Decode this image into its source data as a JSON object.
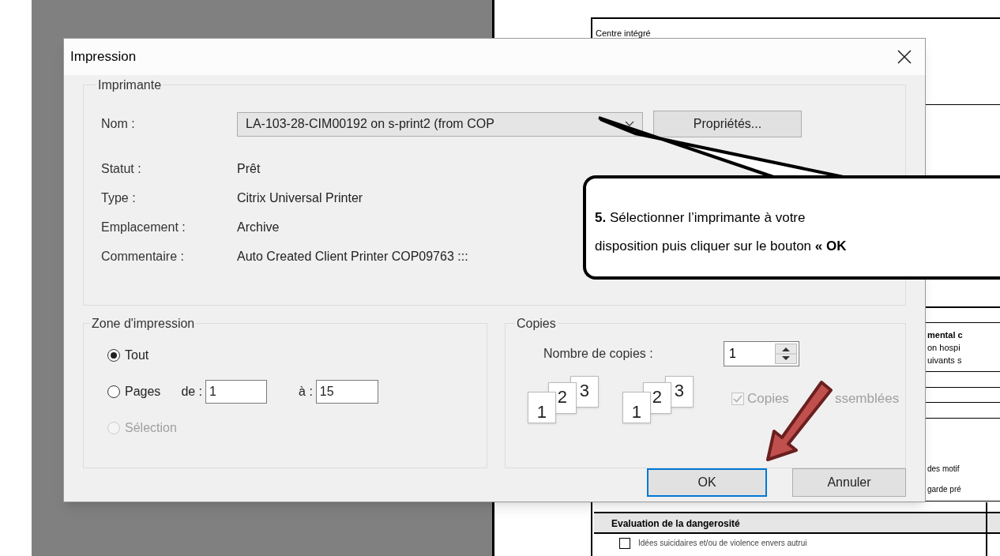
{
  "document": {
    "header": "Centre intégré",
    "fragments": [
      {
        "text": "mental c",
        "bold": true
      },
      {
        "text": "on hospi",
        "bold": false
      },
      {
        "text": "uivants s",
        "bold": false
      },
      {
        "text": "des motif",
        "bold": false
      },
      {
        "text": "garde pré",
        "bold": false
      }
    ],
    "section_title": "Evaluation de la dangerosité",
    "checklist": [
      {
        "label": "Idées suicidaires et/ou de violence envers autrui",
        "checked": false
      }
    ]
  },
  "dialog": {
    "title": "Impression",
    "printer": {
      "legend": "Imprimante",
      "name_label": "Nom :",
      "name_value": "LA-103-28-CIM00192 on s-print2 (from COP",
      "properties_button": "Propriétés...",
      "details": [
        {
          "label": "Statut :",
          "value": "Prêt"
        },
        {
          "label": "Type :",
          "value": "Citrix Universal Printer"
        },
        {
          "label": "Emplacement :",
          "value": "Archive"
        },
        {
          "label": "Commentaire :",
          "value": "Auto Created Client Printer COP09763 :::"
        }
      ]
    },
    "print_range": {
      "legend": "Zone d'impression",
      "options": [
        {
          "label": "Tout",
          "selected": true,
          "disabled": false
        },
        {
          "label": "Pages",
          "selected": false,
          "disabled": false
        },
        {
          "label": "Sélection",
          "selected": false,
          "disabled": true
        }
      ],
      "from_label": "de :",
      "from_value": "1",
      "to_label": "à :",
      "to_value": "15"
    },
    "copies": {
      "legend": "Copies",
      "count_label": "Nombre de copies :",
      "count_value": "1",
      "stacks": [
        [
          "1",
          "2",
          "3"
        ],
        [
          "1",
          "2",
          "3"
        ]
      ],
      "collate": {
        "label_parts": [
          "Copies",
          "ssemblées"
        ],
        "checked": true,
        "disabled": true
      }
    },
    "buttons": [
      {
        "label": "OK",
        "default": true
      },
      {
        "label": "Annuler",
        "default": false
      }
    ]
  },
  "callout": {
    "lines": [
      "**5.** Sélectionner l’imprimante à votre",
      "disposition puis cliquer sur le bouton **« OK**"
    ]
  }
}
